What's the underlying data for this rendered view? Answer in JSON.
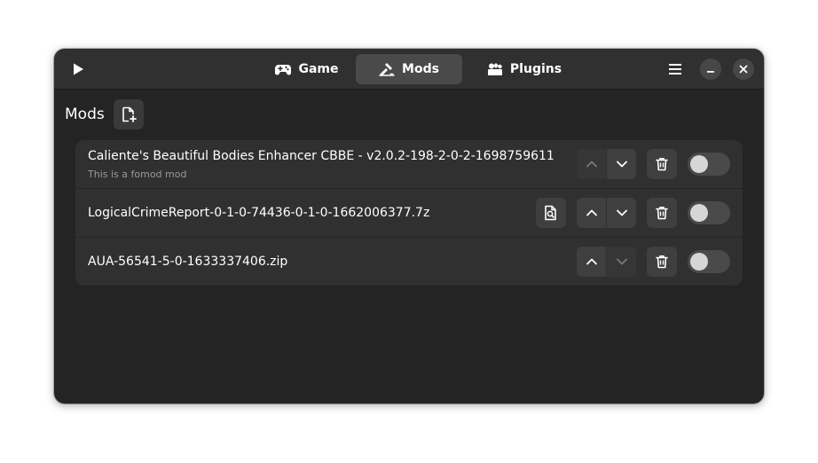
{
  "header": {
    "tabs": [
      {
        "label": "Game",
        "icon": "gamepad-icon",
        "active": false
      },
      {
        "label": "Mods",
        "icon": "puzzle-icon",
        "active": true
      },
      {
        "label": "Plugins",
        "icon": "plugins-icon",
        "active": false
      }
    ]
  },
  "main": {
    "title": "Mods"
  },
  "mods": [
    {
      "name": "Caliente's Beautiful Bodies Enhancer CBBE - v2.0.2-198-2-0-2-1698759611",
      "subtitle": "This is a fomod mod",
      "up_enabled": false,
      "down_enabled": true,
      "enabled": false
    },
    {
      "name": "LogicalCrimeReport-0-1-0-74436-0-1-0-1662006377.7z",
      "subtitle": "",
      "up_enabled": true,
      "down_enabled": true,
      "enabled": false
    },
    {
      "name": "AUA-56541-5-0-1633337406.zip",
      "subtitle": "",
      "up_enabled": true,
      "down_enabled": false,
      "enabled": false
    }
  ],
  "colors": {
    "window_bg": "#242424",
    "headerbar_bg": "#303030",
    "active_tab_bg": "#4a4a4a",
    "list_bg": "#303030",
    "button_bg": "#3f3f3f"
  }
}
